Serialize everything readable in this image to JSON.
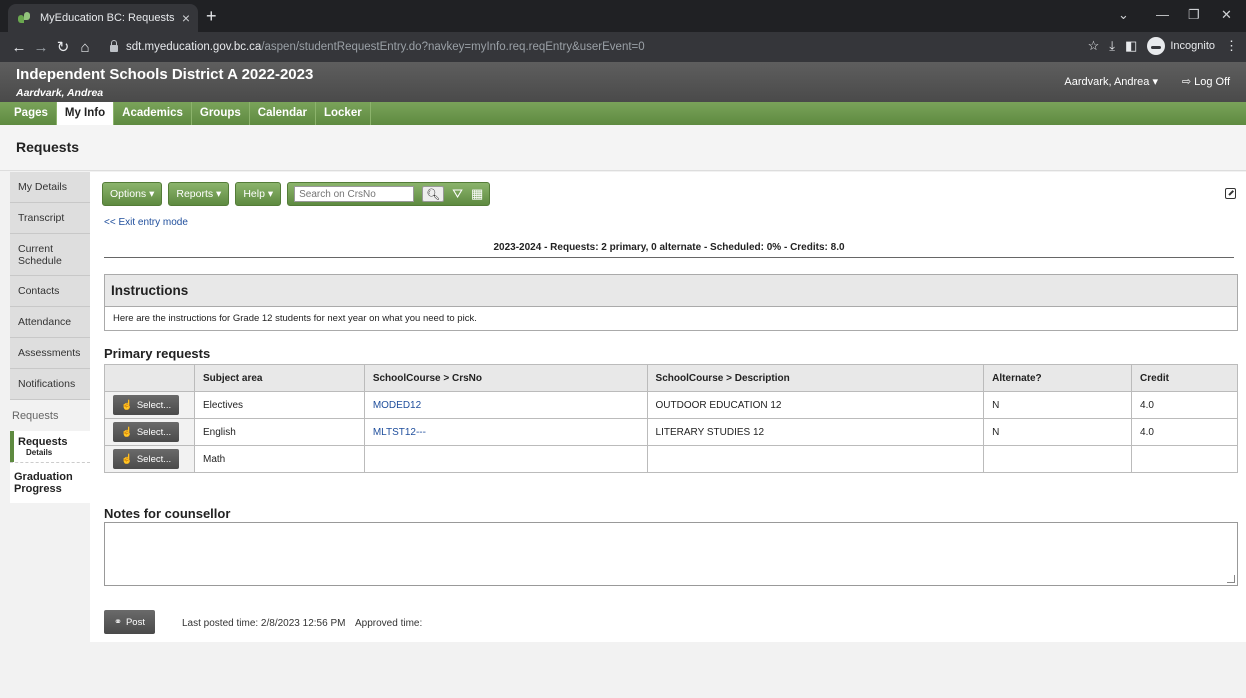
{
  "browser": {
    "tab_title": "MyEducation BC: Requests",
    "tab_close": "×",
    "new_tab": "+",
    "url_host": "sdt.myeducation.gov.bc.ca",
    "url_path": "/aspen/studentRequestEntry.do?navkey=myInfo.req.reqEntry&userEvent=0",
    "incognito_label": "Incognito"
  },
  "header": {
    "school": "Independent Schools District A 2022-2023",
    "student": "Aardvark, Andrea",
    "user_menu": "Aardvark, Andrea ▾",
    "logoff": "⇨ Log Off"
  },
  "nav": {
    "items": [
      "Pages",
      "My Info",
      "Academics",
      "Groups",
      "Calendar",
      "Locker"
    ],
    "active": "My Info"
  },
  "page_title": "Requests",
  "sidebar": {
    "items": [
      "My Details",
      "Transcript",
      "Current Schedule",
      "Contacts",
      "Attendance",
      "Assessments",
      "Notifications"
    ],
    "section": "Requests",
    "sub_item": "Requests",
    "sub_item_detail": "Details",
    "sub_item2": "Graduation Progress"
  },
  "toolbar": {
    "options": "Options ▾",
    "reports": "Reports ▾",
    "help": "Help ▾",
    "search_placeholder": "Search on CrsNo"
  },
  "exit_link": "<< Exit entry mode",
  "summary": "2023-2024 - Requests: 2 primary, 0 alternate - Scheduled: 0% - Credits: 8.0",
  "instructions": {
    "title": "Instructions",
    "body": "Here are the instructions for Grade 12 students for next year on what you need to pick."
  },
  "primary": {
    "title": "Primary requests",
    "columns": [
      "",
      "Subject area",
      "SchoolCourse > CrsNo",
      "SchoolCourse > Description",
      "Alternate?",
      "Credit"
    ],
    "select_label": "Select...",
    "rows": [
      {
        "subject": "Electives",
        "crsno": "MODED12",
        "desc": "OUTDOOR EDUCATION 12",
        "alt": "N",
        "credit": "4.0"
      },
      {
        "subject": "English",
        "crsno": "MLTST12---",
        "desc": "LITERARY STUDIES 12",
        "alt": "N",
        "credit": "4.0"
      },
      {
        "subject": "Math",
        "crsno": "",
        "desc": "",
        "alt": "",
        "credit": ""
      }
    ]
  },
  "notes": {
    "title": "Notes for counsellor"
  },
  "footer": {
    "post": "Post",
    "last_posted": "Last posted time: 2/8/2023 12:56 PM",
    "approved": "Approved time:"
  }
}
